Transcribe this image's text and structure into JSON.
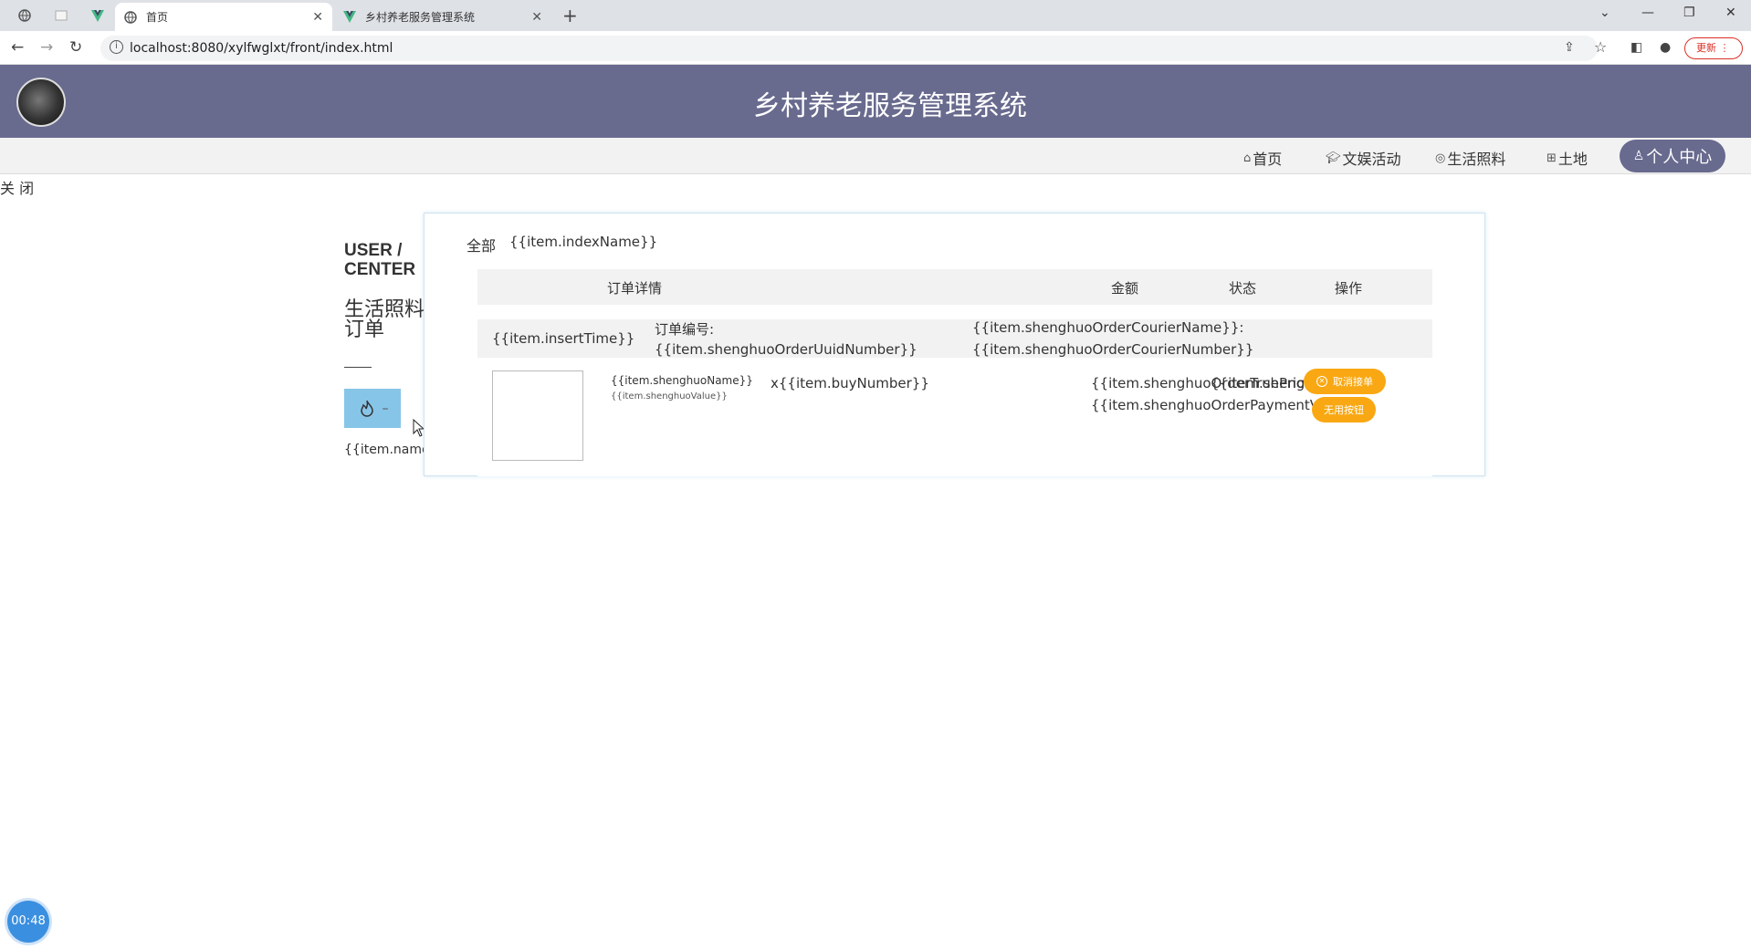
{
  "browser": {
    "tabs": [
      {
        "label": "首页",
        "active": true
      },
      {
        "label": "乡村养老服务管理系统",
        "active": false
      }
    ],
    "url": "localhost:8080/xylfwglxt/front/index.html",
    "update_label": "更新"
  },
  "header": {
    "title": "乡村养老服务管理系统"
  },
  "menu": {
    "items": [
      {
        "label": "首页",
        "icon": "home-icon"
      },
      {
        "label": "文娱活动",
        "icon": "graduation-cap-icon"
      },
      {
        "label": "生活照料",
        "icon": "palette-icon"
      },
      {
        "label": "土地",
        "icon": "gift-icon"
      }
    ],
    "active_label": "个人中心"
  },
  "close_label": "关 闭",
  "user_center": {
    "title_line1": "USER /",
    "title_line2": "CENTER",
    "subtitle": "生活照料订单",
    "button_text": "–",
    "item_name": "{{item.name}}"
  },
  "orders": {
    "filter_all": "全部",
    "filter_index": "{{item.indexName}}",
    "columns": [
      "订单详情",
      "金额",
      "状态",
      "操作"
    ],
    "row": {
      "insert_time": "{{item.insertTime}}",
      "order_no_label": "订单编号:",
      "order_no": "{{item.shenghuoOrderUuidNumber}}",
      "courier_name": "{{item.shenghuoOrderCourierName}}:",
      "courier_number": "{{item.shenghuoOrderCourierNumber}}",
      "product_name": "{{item.shenghuoName}}",
      "product_value": "{{item.shenghuoValue}}",
      "buy_number": "x{{item.buyNumber}}",
      "true_price": "{{item.shenghuoOrderTruePrice}}",
      "status_overlap": "{{item.shenghuoOrderTypes}}",
      "payment_value": "{{item.shenghuoOrderPaymentValue}}",
      "cancel_label": "取消接单",
      "unused_label": "无用按钮"
    }
  },
  "timer": "00:48",
  "colors": {
    "header_bg": "#686a8e",
    "button_orange": "#f9a813",
    "uc_button": "#87c5e8",
    "timer_blue": "#3b8fe0"
  }
}
